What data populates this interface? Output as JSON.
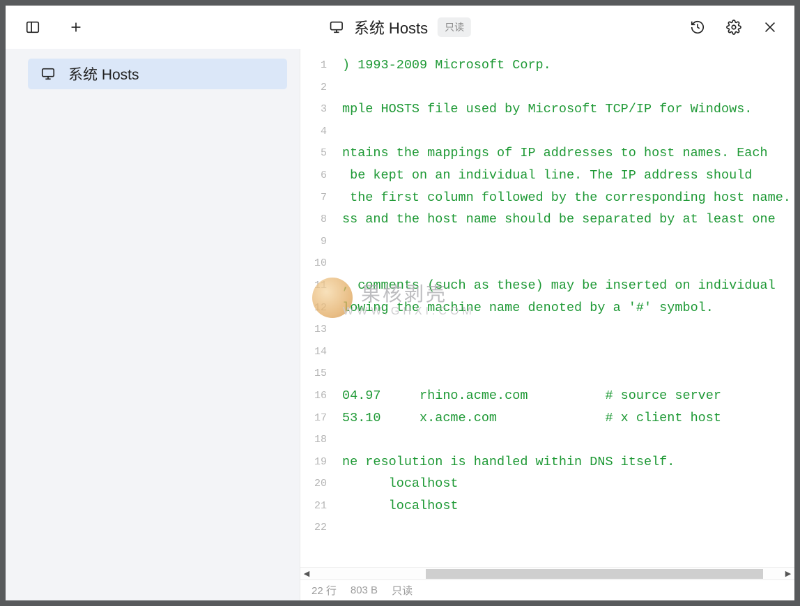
{
  "header": {
    "title": "系统 Hosts",
    "badge": "只读"
  },
  "sidebar": {
    "items": [
      {
        "label": "系统 Hosts"
      }
    ]
  },
  "editor": {
    "lines": [
      ") 1993-2009 Microsoft Corp.",
      "",
      "mple HOSTS file used by Microsoft TCP/IP for Windows.",
      "",
      "ntains the mappings of IP addresses to host names. Each",
      " be kept on an individual line. The IP address should",
      " the first column followed by the corresponding host name.",
      "ss and the host name should be separated by at least one",
      "",
      "",
      ", comments (such as these) may be inserted on individual",
      "lowing the machine name denoted by a '#' symbol.",
      "",
      "",
      "",
      "04.97     rhino.acme.com          # source server",
      "53.10     x.acme.com              # x client host",
      "",
      "ne resolution is handled within DNS itself.",
      "      localhost",
      "      localhost",
      ""
    ]
  },
  "status": {
    "lines": "22 行",
    "size": "803 B",
    "mode": "只读"
  },
  "watermark": {
    "main": "果核剥壳",
    "sub": "WWW.GHXI.COM"
  },
  "scroll_arrows": {
    "left": "◀",
    "right": "▶"
  }
}
